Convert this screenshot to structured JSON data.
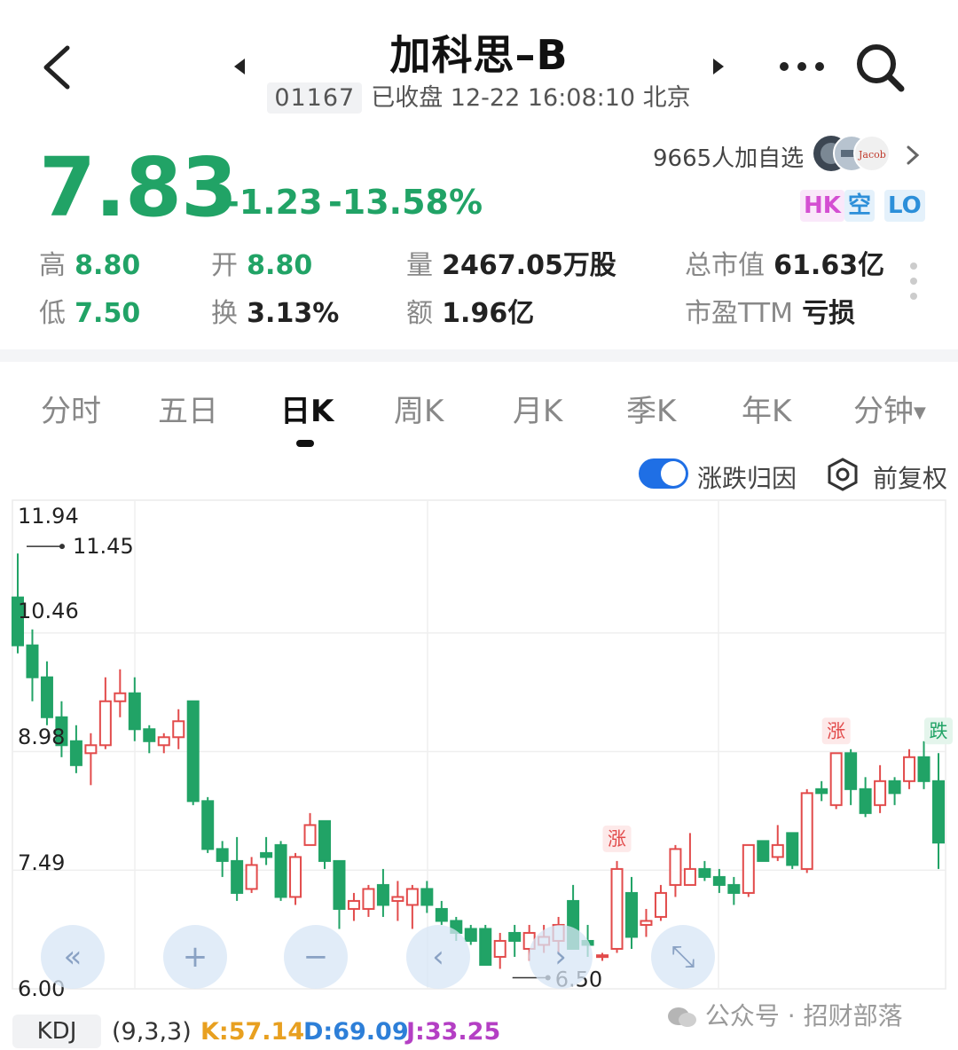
{
  "header": {
    "title": "加科思–B",
    "code": "01167",
    "status": "已收盘 12-22 16:08:10 北京"
  },
  "quote": {
    "price": "7.83",
    "change": "-1.23",
    "change_pct": "-13.58%",
    "followers": "9665人加自选",
    "badges": [
      "HK",
      "空",
      "LO"
    ]
  },
  "stats": [
    {
      "label": "高",
      "value": "8.80"
    },
    {
      "label": "开",
      "value": "8.80"
    },
    {
      "label": "量",
      "value": "2467.05万股"
    },
    {
      "label": "总市值",
      "value": "61.63亿"
    },
    {
      "label": "低",
      "value": "7.50"
    },
    {
      "label": "换",
      "value": "3.13%"
    },
    {
      "label": "额",
      "value": "1.96亿"
    },
    {
      "label": "市盈TTM",
      "value": "亏损"
    }
  ],
  "tabs": [
    "分时",
    "五日",
    "日K",
    "周K",
    "月K",
    "季K",
    "年K",
    "分钟"
  ],
  "active_tab": "日K",
  "chart_options": {
    "toggle_label": "涨跌归因",
    "adjust_label": "前复权",
    "toggle_on": true
  },
  "colors": {
    "up": "#e24b4b",
    "down": "#21a366",
    "accent": "#1f6fe5"
  },
  "chart_data": {
    "type": "candlestick",
    "y_ticks": [
      "11.94",
      "10.46",
      "8.98",
      "7.49",
      "6.00"
    ],
    "ylim": [
      6.0,
      11.94
    ],
    "high_marker": "11.45",
    "low_marker": "6.50",
    "annotations": [
      "涨",
      "涨",
      "跌"
    ],
    "candles": [
      [
        10.9,
        11.45,
        10.2,
        10.3
      ],
      [
        10.3,
        10.5,
        9.6,
        9.9
      ],
      [
        9.9,
        10.1,
        9.3,
        9.4
      ],
      [
        9.4,
        9.6,
        8.9,
        9.05
      ],
      [
        9.1,
        9.3,
        8.7,
        8.8
      ],
      [
        8.95,
        9.2,
        8.55,
        9.05
      ],
      [
        9.05,
        9.9,
        9.0,
        9.6
      ],
      [
        9.6,
        10.0,
        9.4,
        9.7
      ],
      [
        9.7,
        9.9,
        9.1,
        9.25
      ],
      [
        9.25,
        9.3,
        8.95,
        9.1
      ],
      [
        9.05,
        9.2,
        8.95,
        9.15
      ],
      [
        9.15,
        9.5,
        9.0,
        9.35
      ],
      [
        9.6,
        9.6,
        8.3,
        8.35
      ],
      [
        8.35,
        8.4,
        7.7,
        7.75
      ],
      [
        7.75,
        7.85,
        7.4,
        7.6
      ],
      [
        7.6,
        7.9,
        7.1,
        7.2
      ],
      [
        7.25,
        7.65,
        7.2,
        7.55
      ],
      [
        7.7,
        7.9,
        7.55,
        7.65
      ],
      [
        7.8,
        7.85,
        7.1,
        7.15
      ],
      [
        7.15,
        7.7,
        7.05,
        7.65
      ],
      [
        7.8,
        8.2,
        7.8,
        8.05
      ],
      [
        8.1,
        8.1,
        7.5,
        7.6
      ],
      [
        7.6,
        7.6,
        6.75,
        7.0
      ],
      [
        7.0,
        7.2,
        6.85,
        7.1
      ],
      [
        7.0,
        7.3,
        6.9,
        7.25
      ],
      [
        7.3,
        7.5,
        6.9,
        7.05
      ],
      [
        7.1,
        7.35,
        6.85,
        7.15
      ],
      [
        7.05,
        7.3,
        6.75,
        7.25
      ],
      [
        7.25,
        7.35,
        6.95,
        7.05
      ],
      [
        7.0,
        7.1,
        6.8,
        6.85
      ],
      [
        6.85,
        6.9,
        6.6,
        6.7
      ],
      [
        6.75,
        6.8,
        6.55,
        6.6
      ],
      [
        6.75,
        6.8,
        6.3,
        6.3
      ],
      [
        6.4,
        6.7,
        6.25,
        6.6
      ],
      [
        6.7,
        6.8,
        6.4,
        6.6
      ],
      [
        6.5,
        6.8,
        6.35,
        6.7
      ],
      [
        6.55,
        6.8,
        6.45,
        6.65
      ],
      [
        6.6,
        6.9,
        6.45,
        6.8
      ],
      [
        7.1,
        7.3,
        6.5,
        6.5
      ],
      [
        6.6,
        6.8,
        6.4,
        6.55
      ],
      [
        6.4,
        6.45,
        6.35,
        6.42
      ],
      [
        6.5,
        7.6,
        6.45,
        7.5
      ],
      [
        7.2,
        7.4,
        6.5,
        6.65
      ],
      [
        6.8,
        7.0,
        6.65,
        6.85
      ],
      [
        6.9,
        7.3,
        6.85,
        7.2
      ],
      [
        7.3,
        7.8,
        7.15,
        7.75
      ],
      [
        7.3,
        7.95,
        7.3,
        7.5
      ],
      [
        7.5,
        7.6,
        7.35,
        7.4
      ],
      [
        7.4,
        7.5,
        7.2,
        7.3
      ],
      [
        7.3,
        7.4,
        7.05,
        7.2
      ],
      [
        7.2,
        7.8,
        7.15,
        7.8
      ],
      [
        7.85,
        7.85,
        7.6,
        7.6
      ],
      [
        7.65,
        8.05,
        7.6,
        7.8
      ],
      [
        7.95,
        7.9,
        7.5,
        7.55
      ],
      [
        7.5,
        8.5,
        7.45,
        8.45
      ],
      [
        8.5,
        8.6,
        8.35,
        8.45
      ],
      [
        8.3,
        8.95,
        8.25,
        8.95
      ],
      [
        8.95,
        9.0,
        8.3,
        8.5
      ],
      [
        8.5,
        8.65,
        8.15,
        8.2
      ],
      [
        8.3,
        8.8,
        8.2,
        8.6
      ],
      [
        8.6,
        8.65,
        8.3,
        8.45
      ],
      [
        8.6,
        9.0,
        8.5,
        8.9
      ],
      [
        8.9,
        9.1,
        8.5,
        8.6
      ],
      [
        8.6,
        8.95,
        7.5,
        7.83
      ]
    ]
  },
  "kdj": {
    "label": "KDJ",
    "params": "(9,3,3)",
    "k": "K:57.14",
    "d": "D:69.09",
    "j": "J:33.25"
  },
  "watermark": "公众号 · 招财部落"
}
